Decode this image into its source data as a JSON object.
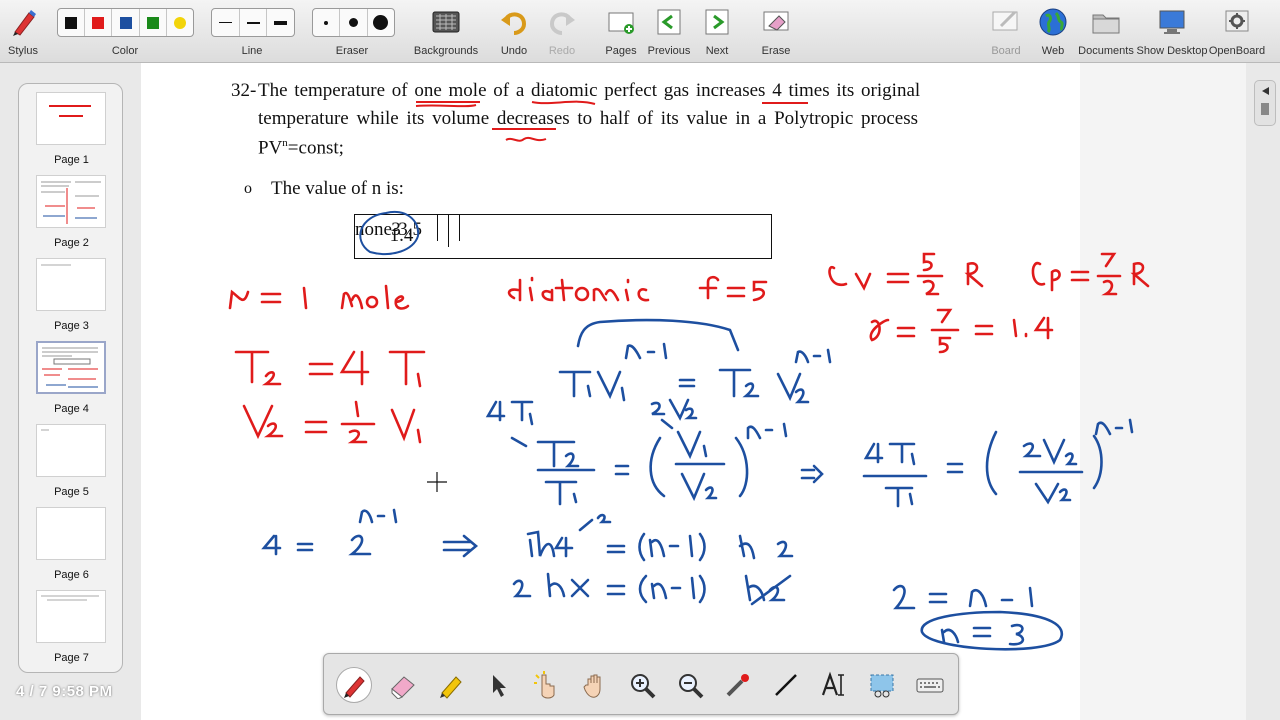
{
  "toolbar": {
    "stylus": "Stylus",
    "color": "Color",
    "line": "Line",
    "eraser": "Eraser",
    "backgrounds": "Backgrounds",
    "undo": "Undo",
    "redo": "Redo",
    "pages": "Pages",
    "previous": "Previous",
    "next": "Next",
    "erase": "Erase",
    "board": "Board",
    "web": "Web",
    "documents": "Documents",
    "show_desktop": "Show Desktop",
    "openboard": "OpenBoard",
    "colors": [
      "#111111",
      "#e01b1b",
      "#1d4fa0",
      "#1a8a1a",
      "#f2d40a"
    ]
  },
  "pages": [
    {
      "label": "Page 1"
    },
    {
      "label": "Page 2"
    },
    {
      "label": "Page 3"
    },
    {
      "label": "Page 4"
    },
    {
      "label": "Page 5"
    },
    {
      "label": "Page 6"
    },
    {
      "label": "Page 7"
    }
  ],
  "clock": "4 / 7 9:58 PM",
  "document": {
    "q_number": "32-",
    "q_line1": "The  temperature of one mole of a diatomic perfect gas increases 4 times its original",
    "q_line2": "temperature while its volume decreases to half of its value in a Polytropic process",
    "q_line3_a": "PV",
    "q_line3_sup": "n",
    "q_line3_b": "=const;",
    "bullet": "o",
    "prompt": "The value of n is:",
    "options": [
      "3",
      "1.4",
      "-3.5",
      "none"
    ]
  },
  "ink": {
    "red": [
      "n = 1 mole",
      "diatomic",
      "f = 5",
      "Cv = 5/2 R",
      "Cp = 7/2 R",
      "γ = 7/5 = 1.4",
      "T2 = 4 T1",
      "V2 = 1/2 V1"
    ],
    "blue": [
      "T1 V1^(n-1) = T2 V2^(n-1)",
      "4 T1",
      "2V2",
      "T2/T1 = (V1/V2)^(n-1)",
      "4T1/T1 = (2V2/V2)^(n-1)",
      "4 = 2^(n-1)",
      "ln 4 = (n-1) ln 2",
      "2 ln2 = (n-1) ln2",
      "2 = n - 1",
      "n = 3"
    ],
    "red_color": "#e01b1b",
    "blue_color": "#1d4fa0"
  }
}
